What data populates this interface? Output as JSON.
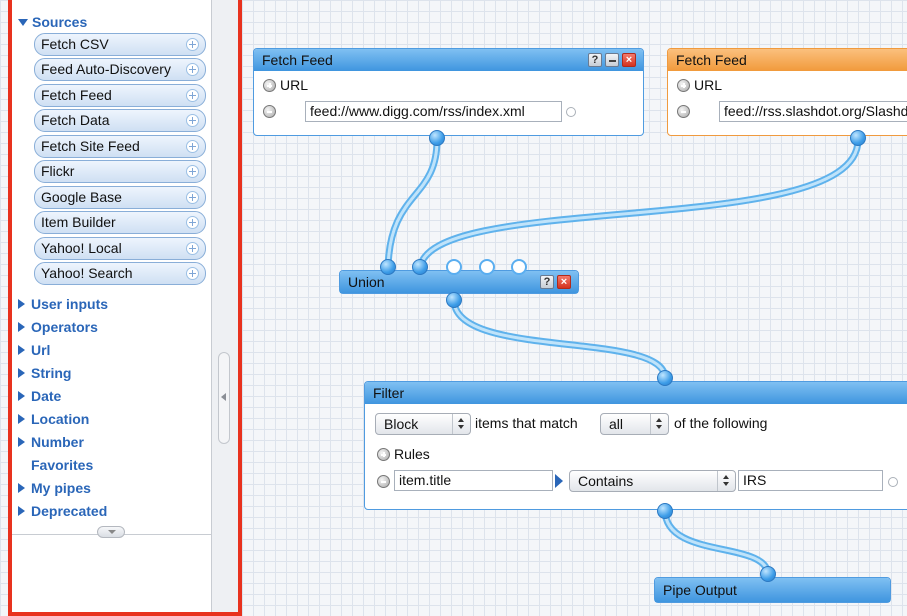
{
  "sidebar": {
    "sources_label": "Sources",
    "sources": [
      "Fetch CSV",
      "Feed Auto-Discovery",
      "Fetch Feed",
      "Fetch Data",
      "Fetch Site Feed",
      "Flickr",
      "Google Base",
      "Item Builder",
      "Yahoo! Local",
      "Yahoo! Search"
    ],
    "categories": [
      {
        "label": "User inputs",
        "expandable": true
      },
      {
        "label": "Operators",
        "expandable": true
      },
      {
        "label": "Url",
        "expandable": true
      },
      {
        "label": "String",
        "expandable": true
      },
      {
        "label": "Date",
        "expandable": true
      },
      {
        "label": "Location",
        "expandable": true
      },
      {
        "label": "Number",
        "expandable": true
      },
      {
        "label": "Favorites",
        "expandable": false
      },
      {
        "label": "My pipes",
        "expandable": true
      },
      {
        "label": "Deprecated",
        "expandable": true
      }
    ]
  },
  "canvas": {
    "fetch_feed_1": {
      "title": "Fetch Feed",
      "help": "?",
      "field_label": "URL",
      "url_value": "feed://www.digg.com/rss/index.xml"
    },
    "fetch_feed_2": {
      "title": "Fetch Feed",
      "field_label": "URL",
      "url_value": "feed://rss.slashdot.org/Slashdot/slashdot"
    },
    "union": {
      "title": "Union",
      "help": "?"
    },
    "filter": {
      "title": "Filter",
      "mode": "Block",
      "text_items_match": "items that match",
      "match": "all",
      "text_following": "of the following",
      "rules_label": "Rules",
      "rule_field": "item.title",
      "rule_operator": "Contains",
      "rule_value": "IRS"
    },
    "pipe_output": {
      "title": "Pipe Output"
    }
  },
  "colors": {
    "module_blue": "#3f95df",
    "module_orange": "#f19a3b",
    "wire": "#7fc6f2",
    "sidebar_highlight": "#e8321e",
    "category_text": "#2a66b8"
  }
}
